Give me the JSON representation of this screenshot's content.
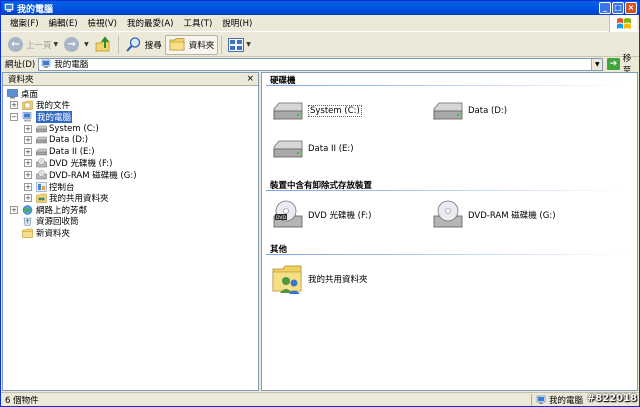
{
  "window": {
    "title": "我的電腦"
  },
  "menu": [
    "檔案(F)",
    "編輯(E)",
    "檢視(V)",
    "我的最愛(A)",
    "工具(T)",
    "說明(H)"
  ],
  "toolbar": {
    "back_label": "上一頁",
    "search_label": "搜尋",
    "folders_label": "資料夾"
  },
  "address": {
    "label": "網址(D)",
    "value": "我的電腦",
    "go_label": "移至"
  },
  "folders_pane": {
    "title": "資料夾",
    "close_glyph": "×",
    "tree": [
      {
        "label": "桌面"
      },
      {
        "label": "我的文件"
      },
      {
        "label": "我的電腦"
      },
      {
        "label": "System (C:)"
      },
      {
        "label": "Data (D:)"
      },
      {
        "label": "Data II (E:)"
      },
      {
        "label": "DVD 光碟機 (F:)"
      },
      {
        "label": "DVD-RAM 磁碟機 (G:)"
      },
      {
        "label": "控制台"
      },
      {
        "label": "我的共用資料夾"
      },
      {
        "label": "網路上的芳鄰"
      },
      {
        "label": "資源回收筒"
      },
      {
        "label": "新資料夾"
      }
    ]
  },
  "content": {
    "groups": [
      {
        "title": "硬碟機",
        "items": [
          "System (C:)",
          "Data (D:)",
          "Data II (E:)"
        ]
      },
      {
        "title": "裝置中含有卸除式存放裝置",
        "items": [
          "DVD 光碟機 (F:)",
          "DVD-RAM 磁碟機 (G:)"
        ]
      },
      {
        "title": "其他",
        "items": [
          "我的共用資料夾"
        ]
      }
    ]
  },
  "statusbar": {
    "count": "6 個物件",
    "location": "我的電腦"
  },
  "watermark": "#822018",
  "colors": {
    "title_bar": "#0058e6",
    "selection": "#316ac5",
    "window_face": "#ece9d8"
  }
}
